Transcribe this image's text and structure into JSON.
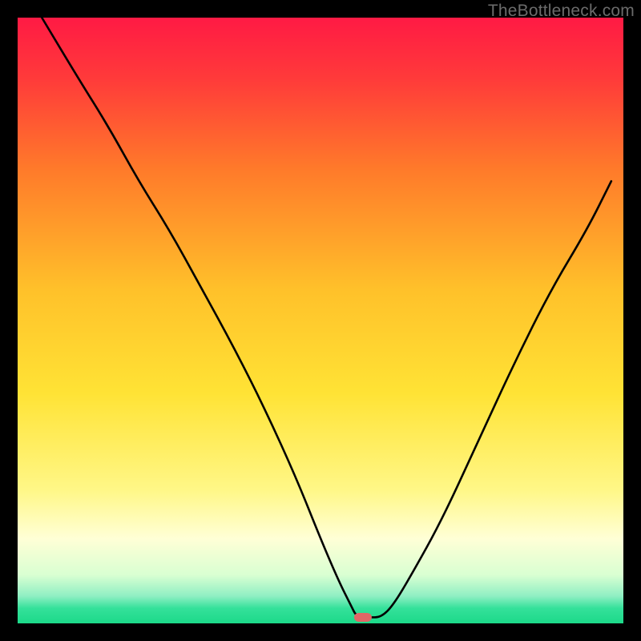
{
  "attribution": "TheBottleneck.com",
  "chart_data": {
    "type": "line",
    "title": "",
    "xlabel": "",
    "ylabel": "",
    "xlim": [
      0,
      100
    ],
    "ylim": [
      0,
      100
    ],
    "background": {
      "type": "vertical-gradient",
      "stops": [
        {
          "offset": 0.0,
          "color": "#ff1a44"
        },
        {
          "offset": 0.1,
          "color": "#ff3a3a"
        },
        {
          "offset": 0.25,
          "color": "#ff7a2a"
        },
        {
          "offset": 0.45,
          "color": "#ffc12a"
        },
        {
          "offset": 0.62,
          "color": "#ffe335"
        },
        {
          "offset": 0.78,
          "color": "#fff787"
        },
        {
          "offset": 0.86,
          "color": "#ffffd6"
        },
        {
          "offset": 0.92,
          "color": "#d9ffd2"
        },
        {
          "offset": 0.955,
          "color": "#8fefc3"
        },
        {
          "offset": 0.975,
          "color": "#34e19a"
        },
        {
          "offset": 1.0,
          "color": "#1cd989"
        }
      ]
    },
    "series": [
      {
        "name": "bottleneck-curve",
        "color": "#000000",
        "x": [
          4,
          10,
          15,
          20,
          25,
          30,
          36,
          41,
          46,
          50,
          53,
          55,
          56,
          58,
          60,
          62,
          65,
          70,
          76,
          82,
          88,
          94,
          98
        ],
        "y": [
          100,
          90,
          82,
          73,
          65,
          56,
          45,
          35,
          24,
          14,
          7,
          3,
          1,
          1,
          1,
          3,
          8,
          17,
          30,
          43,
          55,
          65,
          73
        ]
      }
    ],
    "marker": {
      "name": "optimal-point",
      "x": 57,
      "y": 1,
      "color": "#E06666",
      "shape": "pill"
    },
    "frame": {
      "enabled": true,
      "color": "#000000",
      "thickness": 22
    }
  }
}
